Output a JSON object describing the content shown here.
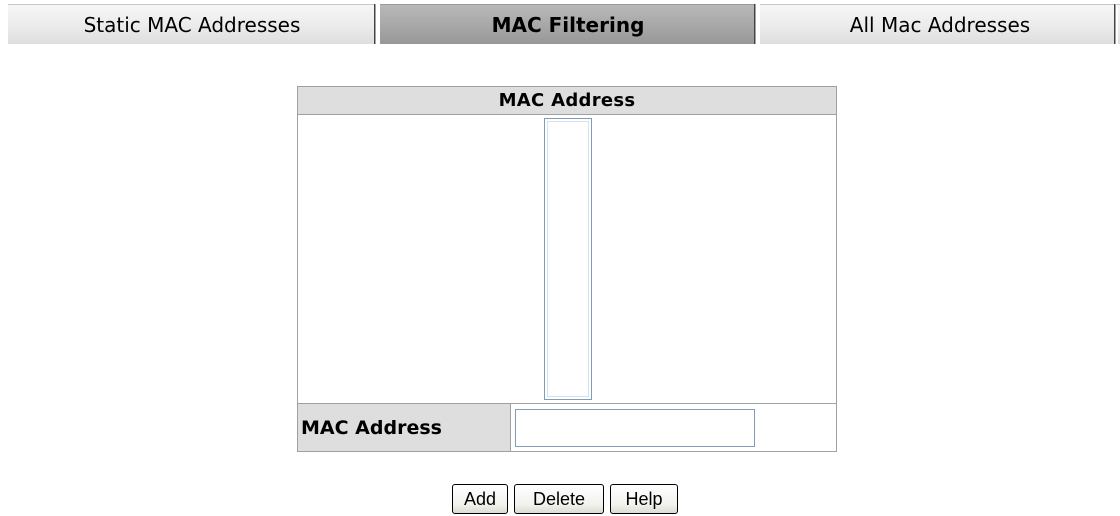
{
  "tabs": [
    {
      "label": "Static MAC Addresses",
      "active": false
    },
    {
      "label": "MAC Filtering",
      "active": true
    },
    {
      "label": "All Mac Addresses",
      "active": false
    }
  ],
  "panel": {
    "header": "MAC Address",
    "listbox_items": [],
    "input_label": "MAC Address",
    "input_value": "",
    "input_placeholder": ""
  },
  "buttons": {
    "add": "Add",
    "delete": "Delete",
    "help": "Help"
  },
  "colors": {
    "active_tab": "#a7a7a7",
    "inactive_tab": "#ebebeb",
    "header_bg": "#dedede",
    "input_border": "#7f9db9"
  }
}
